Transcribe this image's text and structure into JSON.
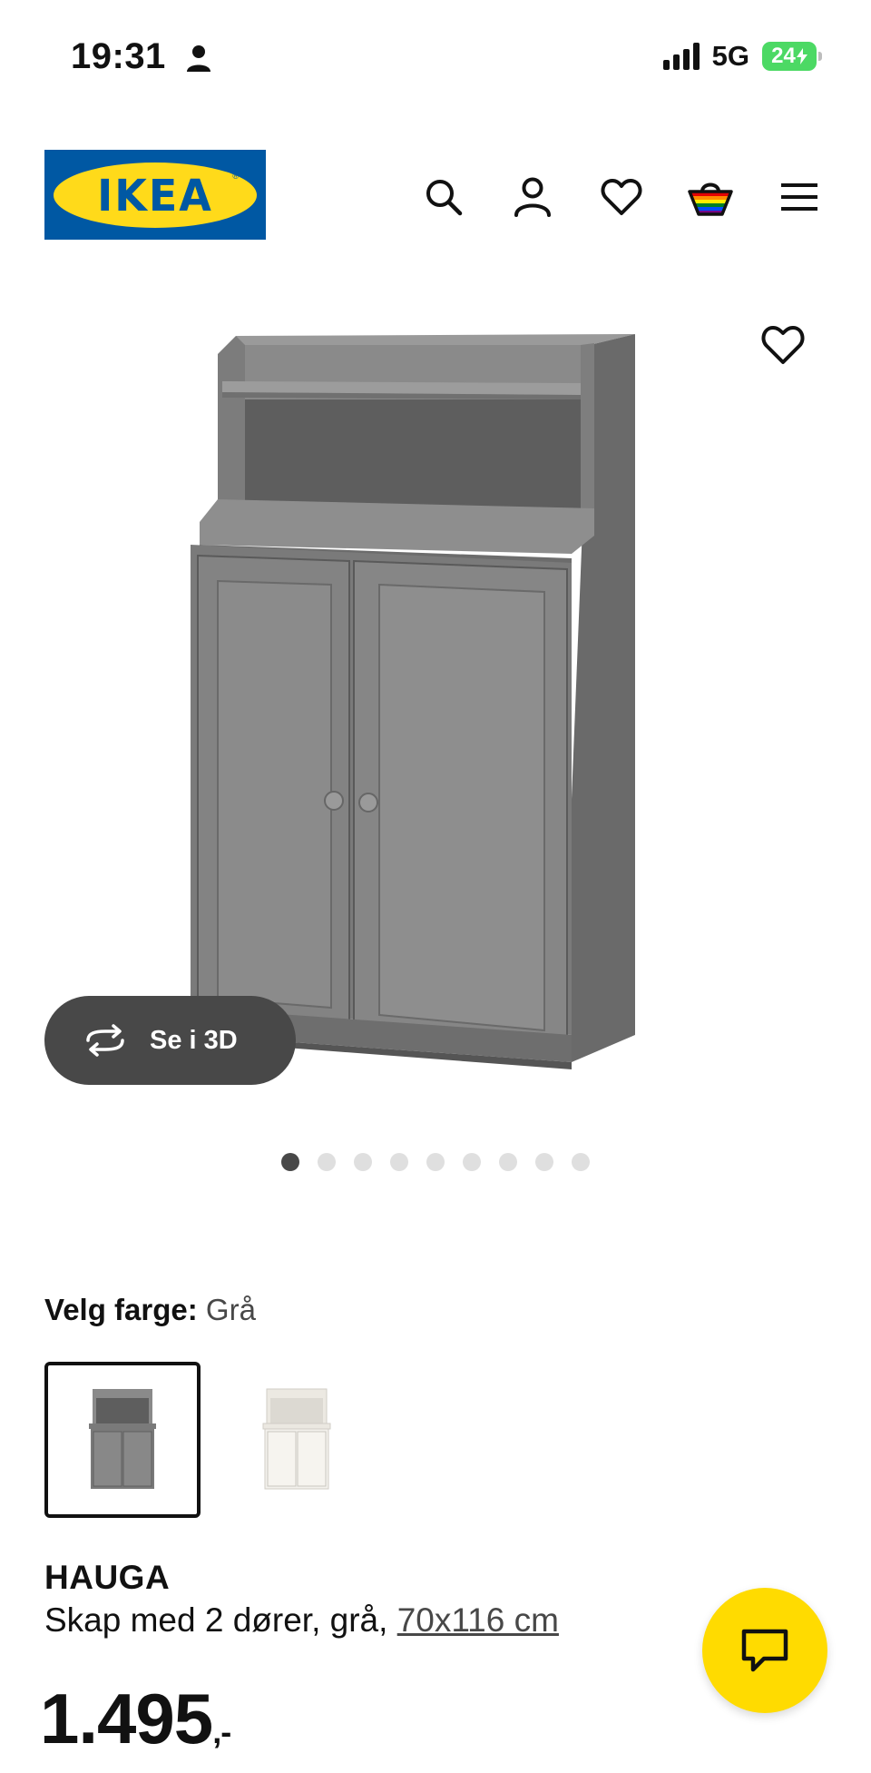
{
  "status_bar": {
    "time": "19:31",
    "network": "5G",
    "battery": "24",
    "icons": [
      "person-icon",
      "signal-icon",
      "battery-charging-icon"
    ]
  },
  "header": {
    "logo_text": "IKEA",
    "logo_reg": "®",
    "icons": [
      "search-icon",
      "account-icon",
      "wishlist-heart-icon",
      "shopping-bag-icon",
      "menu-icon"
    ]
  },
  "gallery": {
    "view_3d_label": "Se i 3D",
    "image_count": 9,
    "active_index": 0
  },
  "color": {
    "label": "Velg farge:",
    "value": "Grå",
    "options": [
      {
        "name": "grey",
        "selected": true,
        "color": "#7a7a7a"
      },
      {
        "name": "white",
        "selected": false,
        "color": "#f3f1ec"
      }
    ]
  },
  "product": {
    "name": "HAUGA",
    "desc_prefix": "Skap med 2 dører, grå, ",
    "size_link": "70x116 cm",
    "price_main": "1.495",
    "price_suffix": ",-"
  },
  "colors": {
    "ikea_blue": "#0058a3",
    "ikea_yellow": "#ffda1a",
    "chat_yellow": "#ffdb00",
    "dark_grey": "#484848"
  }
}
